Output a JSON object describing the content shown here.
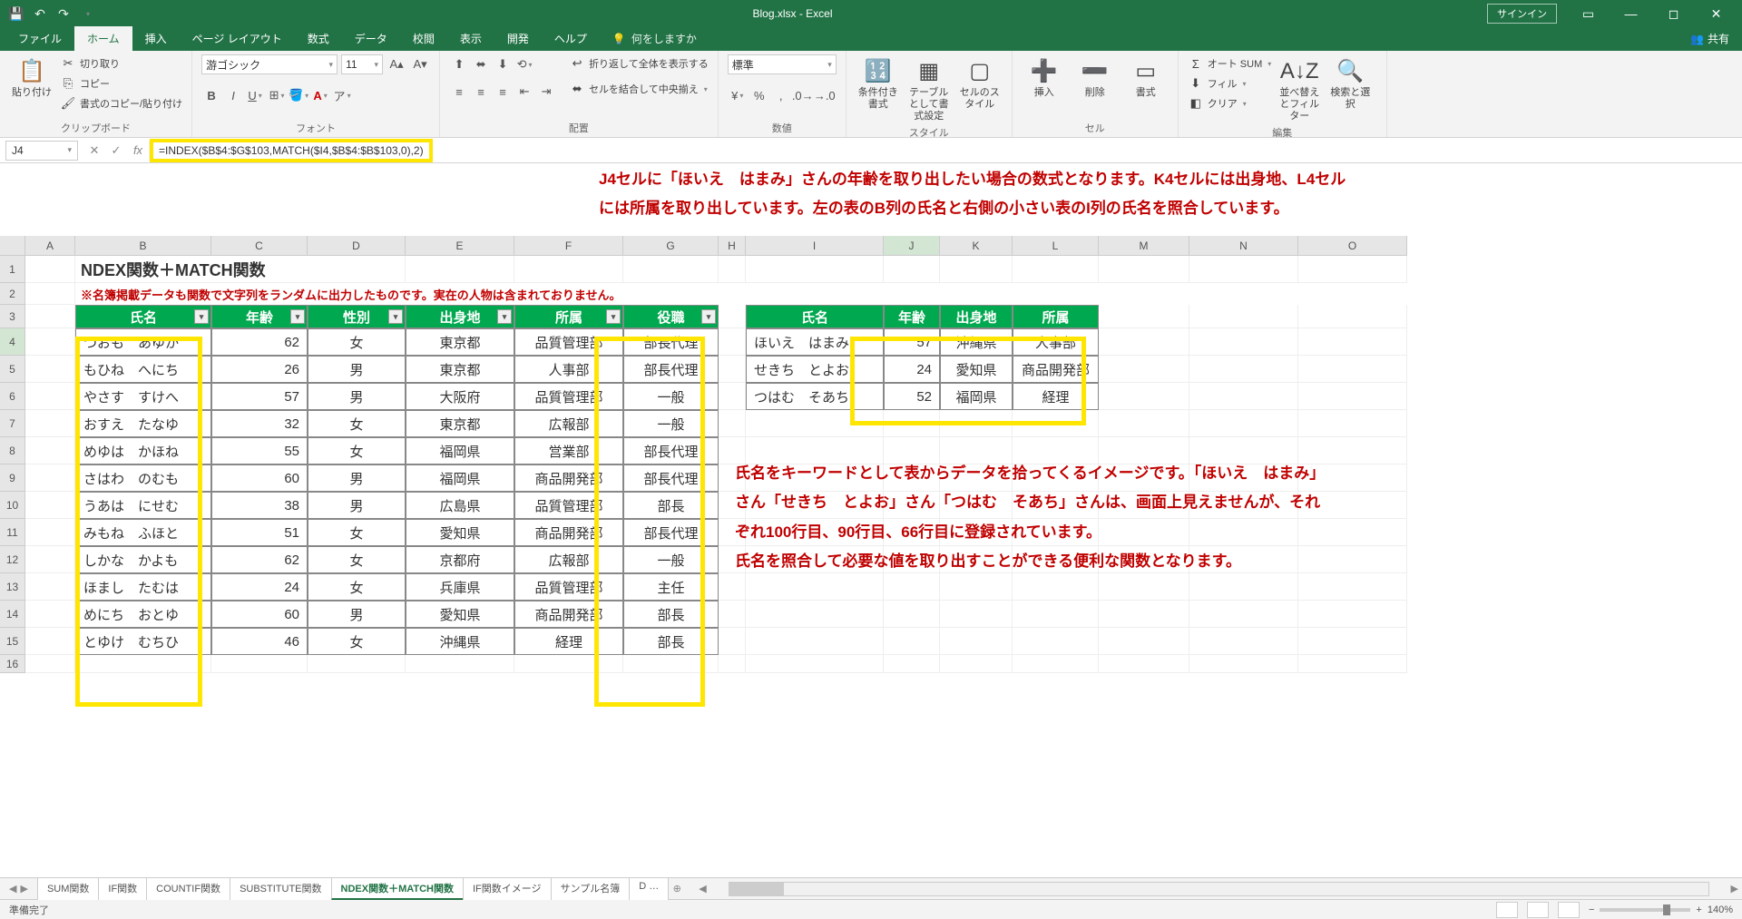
{
  "app": {
    "title": "Blog.xlsx - Excel",
    "signin": "サインイン"
  },
  "tabs": [
    "ファイル",
    "ホーム",
    "挿入",
    "ページ レイアウト",
    "数式",
    "データ",
    "校閲",
    "表示",
    "開発",
    "ヘルプ"
  ],
  "tellme": "何をしますか",
  "share": "共有",
  "ribbon": {
    "clipboard": {
      "paste": "貼り付け",
      "cut": "切り取り",
      "copy": "コピー",
      "painter": "書式のコピー/貼り付け",
      "label": "クリップボード"
    },
    "font": {
      "name": "游ゴシック",
      "size": "11",
      "label": "フォント"
    },
    "align": {
      "wrap": "折り返して全体を表示する",
      "merge": "セルを結合して中央揃え",
      "label": "配置"
    },
    "number": {
      "format": "標準",
      "label": "数値"
    },
    "styles": {
      "cond": "条件付き書式",
      "table": "テーブルとして書式設定",
      "cell": "セルのスタイル",
      "label": "スタイル"
    },
    "cells": {
      "insert": "挿入",
      "delete": "削除",
      "format": "書式",
      "label": "セル"
    },
    "editing": {
      "sum": "オート SUM",
      "fill": "フィル",
      "clear": "クリア",
      "sort": "並べ替えとフィルター",
      "find": "検索と選択",
      "label": "編集"
    }
  },
  "namebox": "J4",
  "formula": "=INDEX($B$4:$G$103,MATCH($I4,$B$4:$B$103,0),2)",
  "annot1": "J4セルに「ほいえ　はまみ」さんの年齢を取り出したい場合の数式となります。K4セルには出身地、L4セルには所属を取り出しています。左の表のB列の氏名と右側の小さい表のI列の氏名を照合しています。",
  "annot2": "氏名をキーワードとして表からデータを拾ってくるイメージです。「ほいえ　はまみ」さん「せきち　とよお」さん「つはむ　そあち」さんは、画面上見えませんが、それぞれ100行目、90行目、66行目に登録されています。\n氏名を照合して必要な値を取り出すことができる便利な関数となります。",
  "cols": [
    "A",
    "B",
    "C",
    "D",
    "E",
    "F",
    "G",
    "H",
    "I",
    "J",
    "K",
    "L",
    "M",
    "N",
    "O"
  ],
  "row1_title": "NDEX関数＋MATCH関数",
  "row2_note": "※名簿掲載データも関数で文字列をランダムに出力したものです。実在の人物は含まれておりません。",
  "left_headers": [
    "氏名",
    "年齢",
    "性別",
    "出身地",
    "所属",
    "役職"
  ],
  "right_headers": [
    "氏名",
    "年齢",
    "出身地",
    "所属"
  ],
  "left_rows": [
    [
      "つおも　あゆか",
      "62",
      "女",
      "東京都",
      "品質管理部",
      "部長代理"
    ],
    [
      "もひね　へにち",
      "26",
      "男",
      "東京都",
      "人事部",
      "部長代理"
    ],
    [
      "やさす　すけへ",
      "57",
      "男",
      "大阪府",
      "品質管理部",
      "一般"
    ],
    [
      "おすえ　たなゆ",
      "32",
      "女",
      "東京都",
      "広報部",
      "一般"
    ],
    [
      "めゆは　かほね",
      "55",
      "女",
      "福岡県",
      "営業部",
      "部長代理"
    ],
    [
      "さはわ　のむも",
      "60",
      "男",
      "福岡県",
      "商品開発部",
      "部長代理"
    ],
    [
      "うあは　にせむ",
      "38",
      "男",
      "広島県",
      "品質管理部",
      "部長"
    ],
    [
      "みもね　ふほと",
      "51",
      "女",
      "愛知県",
      "商品開発部",
      "部長代理"
    ],
    [
      "しかな　かよも",
      "62",
      "女",
      "京都府",
      "広報部",
      "一般"
    ],
    [
      "ほまし　たむは",
      "24",
      "女",
      "兵庫県",
      "品質管理部",
      "主任"
    ],
    [
      "めにち　おとゆ",
      "60",
      "男",
      "愛知県",
      "商品開発部",
      "部長"
    ],
    [
      "とゆけ　むちひ",
      "46",
      "女",
      "沖縄県",
      "経理",
      "部長"
    ]
  ],
  "right_rows": [
    [
      "ほいえ　はまみ",
      "57",
      "沖縄県",
      "人事部"
    ],
    [
      "せきち　とよお",
      "24",
      "愛知県",
      "商品開発部"
    ],
    [
      "つはむ　そあち",
      "52",
      "福岡県",
      "経理"
    ]
  ],
  "sheet_tabs": [
    "SUM関数",
    "IF関数",
    "COUNTIF関数",
    "SUBSTITUTE関数",
    "NDEX関数＋MATCH関数",
    "IF関数イメージ",
    "サンプル名簿",
    "D …"
  ],
  "active_sheet": 4,
  "status": {
    "ready": "準備完了",
    "zoom": "140%"
  }
}
